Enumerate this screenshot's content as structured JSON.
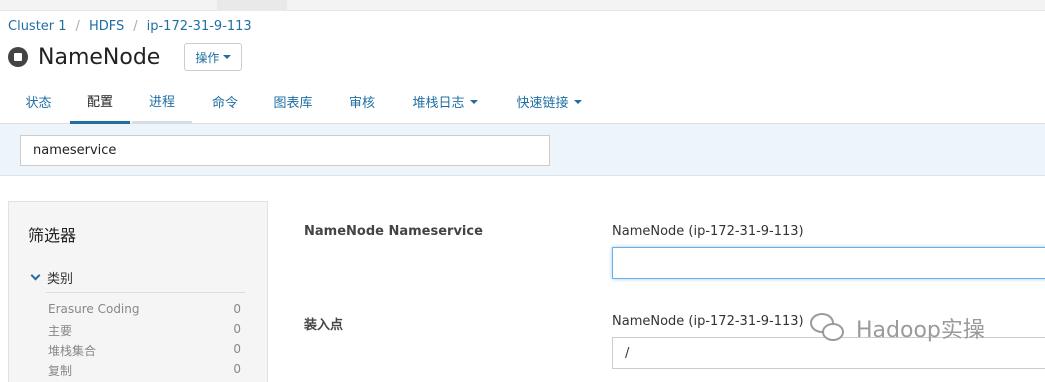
{
  "breadcrumb": [
    "Cluster 1",
    "HDFS",
    "ip-172-31-9-113"
  ],
  "header": {
    "title": "NameNode",
    "actions_label": "操作"
  },
  "tabs": [
    {
      "label": "状态"
    },
    {
      "label": "配置"
    },
    {
      "label": "进程"
    },
    {
      "label": "命令"
    },
    {
      "label": "图表库"
    },
    {
      "label": "审核"
    },
    {
      "label": "堆栈日志"
    },
    {
      "label": "快速链接"
    }
  ],
  "search": {
    "value": "nameservice"
  },
  "filters": {
    "title": "筛选器",
    "category_label": "类别",
    "items": [
      {
        "label": "Erasure Coding",
        "count": "0"
      },
      {
        "label": "主要",
        "count": "0"
      },
      {
        "label": "堆栈集合",
        "count": "0"
      },
      {
        "label": "复制",
        "count": "0"
      }
    ]
  },
  "properties": [
    {
      "label": "NameNode Nameservice",
      "scope": "NameNode (ip-172-31-9-113)",
      "value": ""
    },
    {
      "label": "装入点",
      "scope": "NameNode (ip-172-31-9-113)",
      "value": "/"
    }
  ],
  "watermark": {
    "text": "Hadoop实操"
  }
}
